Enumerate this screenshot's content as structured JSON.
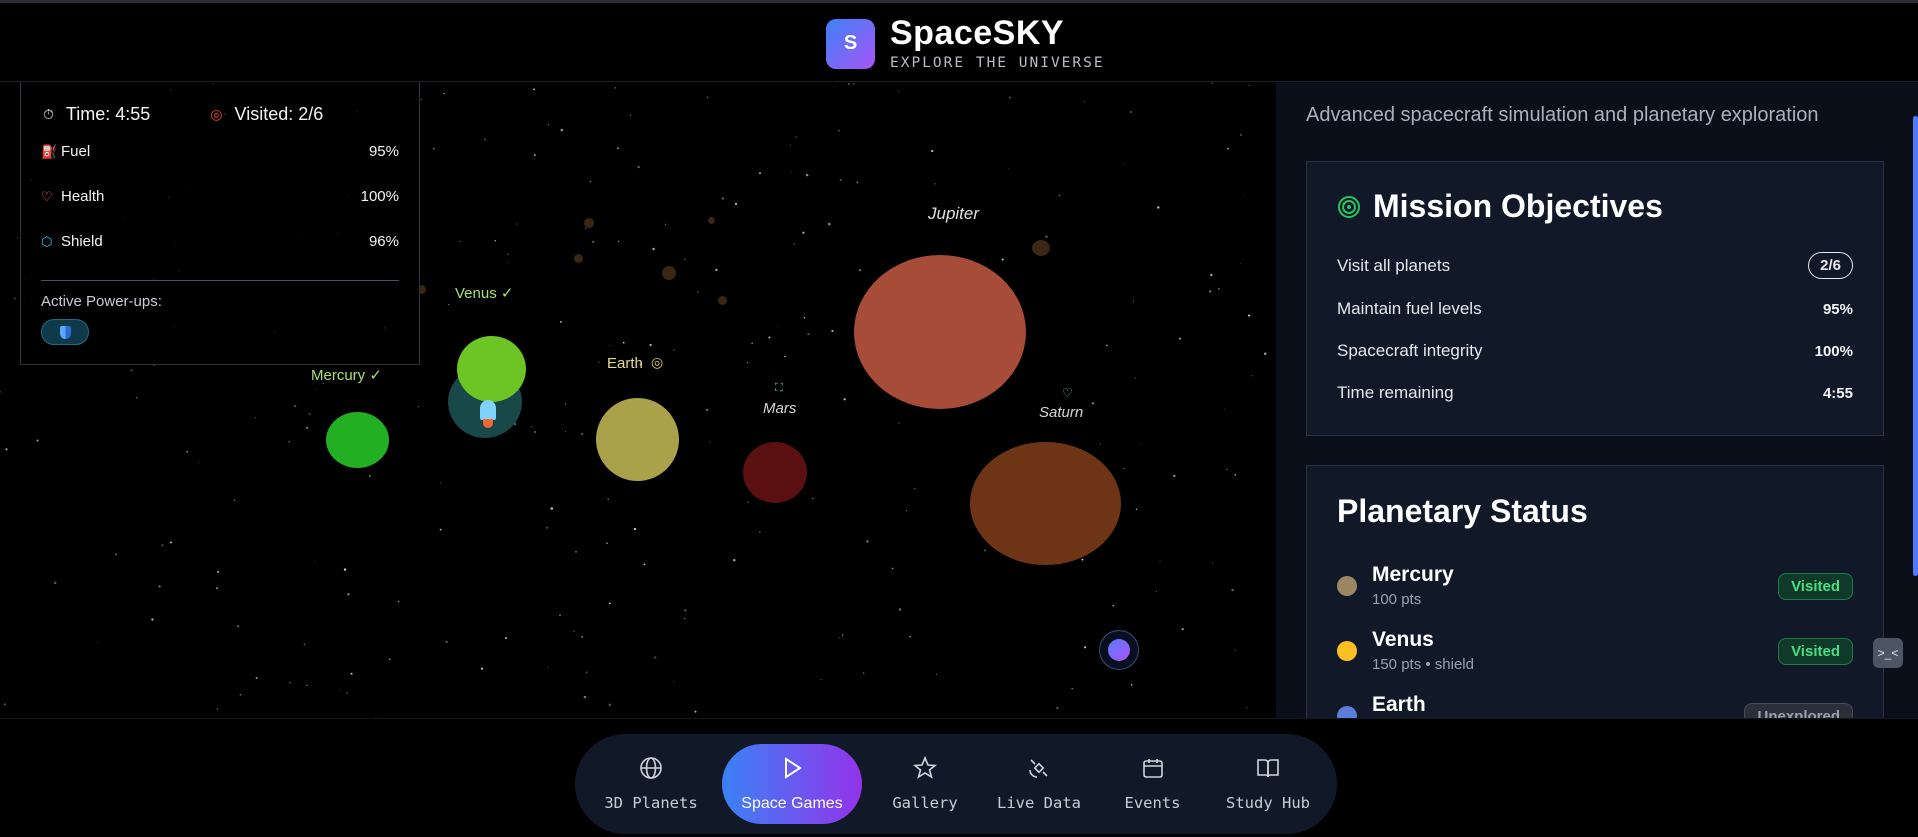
{
  "brand": {
    "logo_letter": "S",
    "name": "SpaceSKY",
    "tagline": "EXPLORE THE UNIVERSE"
  },
  "hud": {
    "time": "Time: 4:55",
    "visited": "Visited: 2/6",
    "stats": [
      {
        "label": "Fuel",
        "value": "95%",
        "icon": "fuel-icon"
      },
      {
        "label": "Health",
        "value": "100%",
        "icon": "heart-icon"
      },
      {
        "label": "Shield",
        "value": "96%",
        "icon": "shield-icon"
      }
    ],
    "powerups_label": "Active Power-ups:"
  },
  "planet_labels": {
    "mercury": "Mercury ✓",
    "venus": "Venus ✓",
    "earth": "Earth",
    "mars": "Mars",
    "jupiter": "Jupiter",
    "saturn": "Saturn"
  },
  "right": {
    "subtitle": "Advanced spacecraft simulation and planetary exploration",
    "objectives": {
      "title": "Mission Objectives",
      "rows": [
        {
          "label": "Visit all planets",
          "value": "2/6"
        },
        {
          "label": "Maintain fuel levels",
          "value": "95%"
        },
        {
          "label": "Spacecraft integrity",
          "value": "100%"
        },
        {
          "label": "Time remaining",
          "value": "4:55"
        }
      ]
    },
    "planetary_status": {
      "title": "Planetary Status",
      "rows": [
        {
          "name": "Mercury",
          "sub": "100 pts",
          "status": "Visited",
          "color": "#9a8660"
        },
        {
          "name": "Venus",
          "sub": "150 pts • shield",
          "status": "Visited",
          "color": "#fbbf24"
        },
        {
          "name": "Earth",
          "sub": "",
          "status": "Unexplored",
          "color": "#5b7fd9"
        }
      ]
    }
  },
  "side_button": ">_<",
  "nav": {
    "items": [
      {
        "label": "3D Planets",
        "icon": "globe-icon"
      },
      {
        "label": "Space Games",
        "icon": "play-icon"
      },
      {
        "label": "Gallery",
        "icon": "star-icon"
      },
      {
        "label": "Live Data",
        "icon": "satellite-icon"
      },
      {
        "label": "Events",
        "icon": "calendar-icon"
      },
      {
        "label": "Study Hub",
        "icon": "book-icon"
      }
    ]
  }
}
